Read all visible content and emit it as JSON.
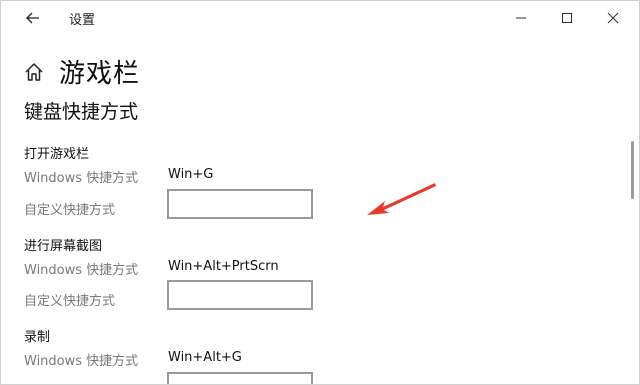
{
  "window": {
    "title": "设置",
    "back_icon": "back-arrow-icon",
    "min_icon": "minimize-icon",
    "max_icon": "maximize-icon",
    "close_icon": "close-icon"
  },
  "page": {
    "home_icon": "home-icon",
    "title": "游戏栏"
  },
  "section": {
    "title": "键盘快捷方式"
  },
  "groups": [
    {
      "heading": "打开游戏栏",
      "windows_label": "Windows 快捷方式",
      "windows_value": "Win+G",
      "custom_label": "自定义快捷方式",
      "custom_value": ""
    },
    {
      "heading": "进行屏幕截图",
      "windows_label": "Windows 快捷方式",
      "windows_value": "Win+Alt+PrtScrn",
      "custom_label": "自定义快捷方式",
      "custom_value": ""
    },
    {
      "heading": "录制",
      "windows_label": "Windows 快捷方式",
      "windows_value": "Win+Alt+G",
      "custom_label": "",
      "custom_value": ""
    }
  ],
  "annotation": {
    "arrow_icon": "red-arrow-annotation-icon",
    "color": "#e8392b"
  }
}
